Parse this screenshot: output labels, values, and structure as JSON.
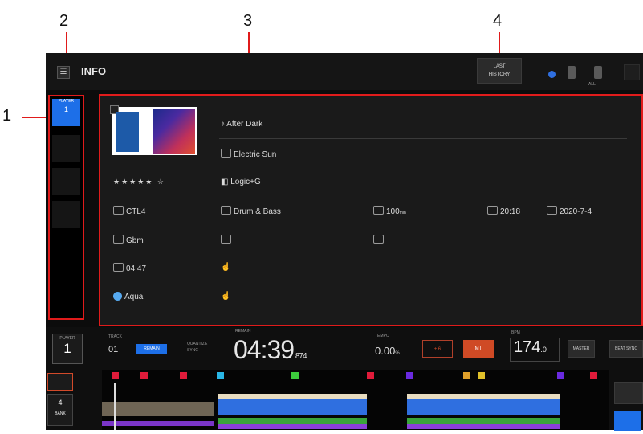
{
  "callouts": {
    "c1": "1",
    "c2": "2",
    "c3": "3",
    "c4": "4"
  },
  "header": {
    "title": "INFO",
    "menu_icon": "menu-icon",
    "sync_line1": "LAST",
    "sync_line2": "HISTORY",
    "status_label": "ALL"
  },
  "sidebar": {
    "decks": [
      {
        "label": "PLAYER",
        "num": "1"
      },
      {
        "label": "",
        "num": ""
      },
      {
        "label": "",
        "num": ""
      },
      {
        "label": "",
        "num": ""
      }
    ]
  },
  "track": {
    "title": "After Dark",
    "artist": "Electric Sun",
    "album": "Logic+G",
    "rating": "★★★★★ ☆",
    "genre": "Drum & Bass",
    "length": "100",
    "length_unit": "min",
    "date_added": "20:18",
    "release_date": "2020-7-4",
    "key": "Gbm",
    "comment": "",
    "duration": "04:47",
    "color": "Aqua",
    "track_no_prefix": "CTL4"
  },
  "deck_panel": {
    "deck_label": "PLAYER",
    "deck_number": "1",
    "track_label": "TRACK",
    "track_number": "01",
    "mode": "REMAIN",
    "time_mode_line1": "QUANTIZE",
    "time_mode_line2": "SYNC",
    "time_main": "04:39",
    "time_frac": ".8",
    "time_suffix": "74",
    "remain_label": "REMAIN",
    "tempo_label": "TEMPO",
    "pitch_value": "0.00",
    "pitch_unit": "%",
    "btn_outline": "± 6",
    "btn_red": "MT",
    "bpm_label": "BPM",
    "bpm_value": "174",
    "bpm_frac": ".0",
    "btn_master": "MASTER",
    "btn_sync": "BEAT SYNC",
    "deck2_number": "4",
    "deck2_label": "BANK"
  },
  "colors": {
    "accent": "#1d6fe8",
    "callout": "#e01b1b",
    "cue_colors": [
      "#e01b3a",
      "#e01b3a",
      "#e01b3a",
      "#29b6e6",
      "#3ccc3c",
      "#e01b3a",
      "#6a2ae0",
      "#e0a02a",
      "#e0c02a",
      "#6a2ae0",
      "#e01b3a"
    ]
  }
}
